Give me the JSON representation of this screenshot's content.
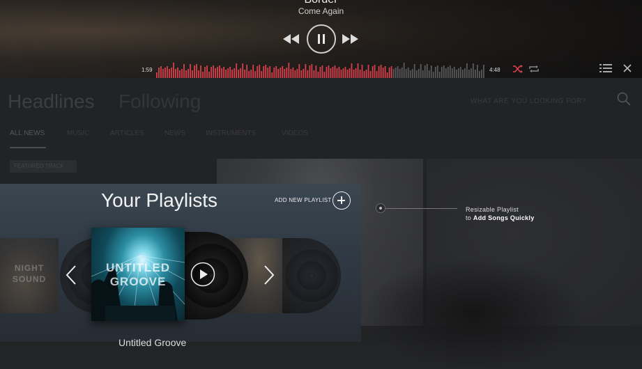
{
  "player": {
    "title": "Border",
    "artist": "Come Again",
    "time_elapsed": "1:59",
    "time_total": "4:48",
    "progress": 0.72,
    "accent_color": "#d8404b"
  },
  "nav": {
    "tabs": [
      "Headlines",
      "Following"
    ],
    "search_placeholder": "WHAT ARE YOU LOOKING FOR?",
    "subtabs": [
      "ALL NEWS",
      "MUSIC",
      "ARTICLES",
      "NEWS",
      "INSTRUMENTS",
      "VIDEOS"
    ],
    "featured_label": "FEATURED TRACK"
  },
  "playlists": {
    "heading": "Your Playlists",
    "add_label": "ADD NEW PLAYLIST",
    "center_cover_line1": "UNTITLED",
    "center_cover_line2": "GROOVE",
    "left_cover_line1": "NIGHT",
    "left_cover_line2": "SOUND",
    "current_name": "Untitled Groove"
  },
  "hint": {
    "line1": "Resizable Playlist",
    "line2_prefix": "to ",
    "line2_bold": "Add Songs Quickly"
  }
}
